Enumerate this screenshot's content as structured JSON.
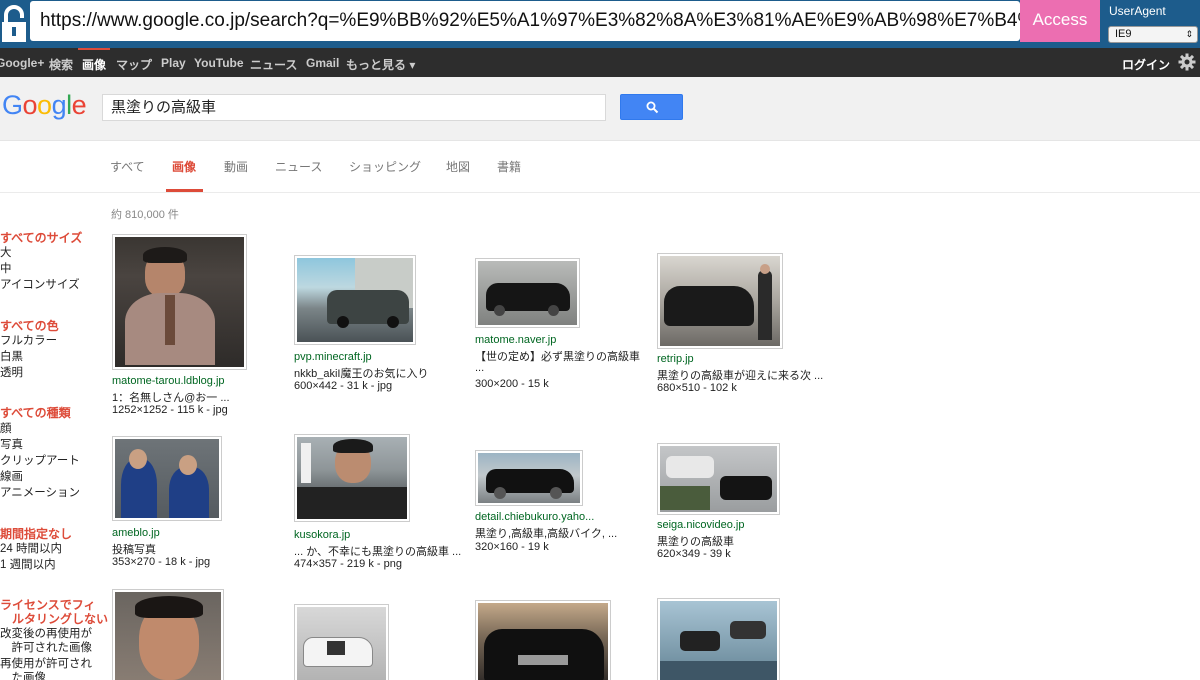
{
  "proxy": {
    "url": "https://www.google.co.jp/search?q=%E9%BB%92%E5%A1%97%E3%82%8A%E3%81%AE%E9%AB%98%E7%B4%",
    "access_label": "Access",
    "useragent_label": "UserAgent",
    "useragent_value": "IE9"
  },
  "gbar": {
    "items": [
      "Google+",
      "検索",
      "画像",
      "マップ",
      "Play",
      "YouTube",
      "ニュース",
      "Gmail",
      "もっと見る ▾"
    ],
    "active_index": 2,
    "login": "ログイン"
  },
  "search": {
    "logo": [
      "G",
      "o",
      "o",
      "g",
      "l",
      "e"
    ],
    "query": "黒塗りの高級車"
  },
  "tabs": {
    "items": [
      "すべて",
      "画像",
      "動画",
      "ニュース",
      "ショッピング",
      "地図",
      "書籍"
    ],
    "active_index": 1
  },
  "result_count": "約 810,000 件",
  "filters": [
    {
      "head": "すべてのサイズ",
      "items": [
        "大",
        "中",
        "アイコンサイズ"
      ]
    },
    {
      "head": "すべての色",
      "items": [
        "フルカラー",
        "白黒",
        "透明"
      ]
    },
    {
      "head": "すべての種類",
      "items": [
        "顔",
        "写真",
        "クリップアート",
        "線画",
        "アニメーション"
      ]
    },
    {
      "head": "期間指定なし",
      "items": [
        "24 時間以内",
        "1 週間以内"
      ]
    },
    {
      "head": "ライセンスでフィ\n　ルタリングしない",
      "items": [
        "改変後の再使用が\n　許可された画像",
        "再使用が許可され\n　た画像"
      ]
    }
  ],
  "results": [
    {
      "source": "matome-tarou.ldblog.jp",
      "caption": "1：名無しさん@お一 ...",
      "meta": "1252×1252 - 115 k - jpg"
    },
    {
      "source": "pvp.minecraft.jp",
      "caption": "nkkb_akiI魔王のお気に入り",
      "meta": "600×442 - 31 k - jpg"
    },
    {
      "source": "matome.naver.jp",
      "caption": "【世の定め】必ず黒塗りの高級車",
      "caption2": "...",
      "meta": "300×200 - 15 k"
    },
    {
      "source": "retrip.jp",
      "caption": "黒塗りの高級車が迎えに来る次 ...",
      "meta": "680×510 - 102 k"
    },
    {
      "source": "ameblo.jp",
      "caption": "投稿写真",
      "meta": "353×270 - 18 k - jpg"
    },
    {
      "source": "kusokora.jp",
      "caption": "... か、不幸にも黒塗りの高級車 ...",
      "meta": "474×357 - 219 k - png"
    },
    {
      "source": "detail.chiebukuro.yaho...",
      "caption": "黒塗り,高級車,高級バイク, ...",
      "meta": "320×160 - 19 k"
    },
    {
      "source": "seiga.nicovideo.jp",
      "caption": "黒塗りの高級車",
      "meta": "620×349 - 39 k"
    },
    {
      "source": "",
      "caption": "",
      "meta": ""
    },
    {
      "source": "",
      "caption": "",
      "meta": ""
    },
    {
      "source": "",
      "caption": "",
      "meta": ""
    },
    {
      "source": "",
      "caption": "",
      "meta": ""
    }
  ],
  "colors": {
    "topbar": "#1d5c8c",
    "access": "#ec6eb1",
    "gbar": "#2d2d2d",
    "accent_red": "#dd4b39",
    "link_green": "#006621",
    "search_blue": "#4285f4"
  }
}
